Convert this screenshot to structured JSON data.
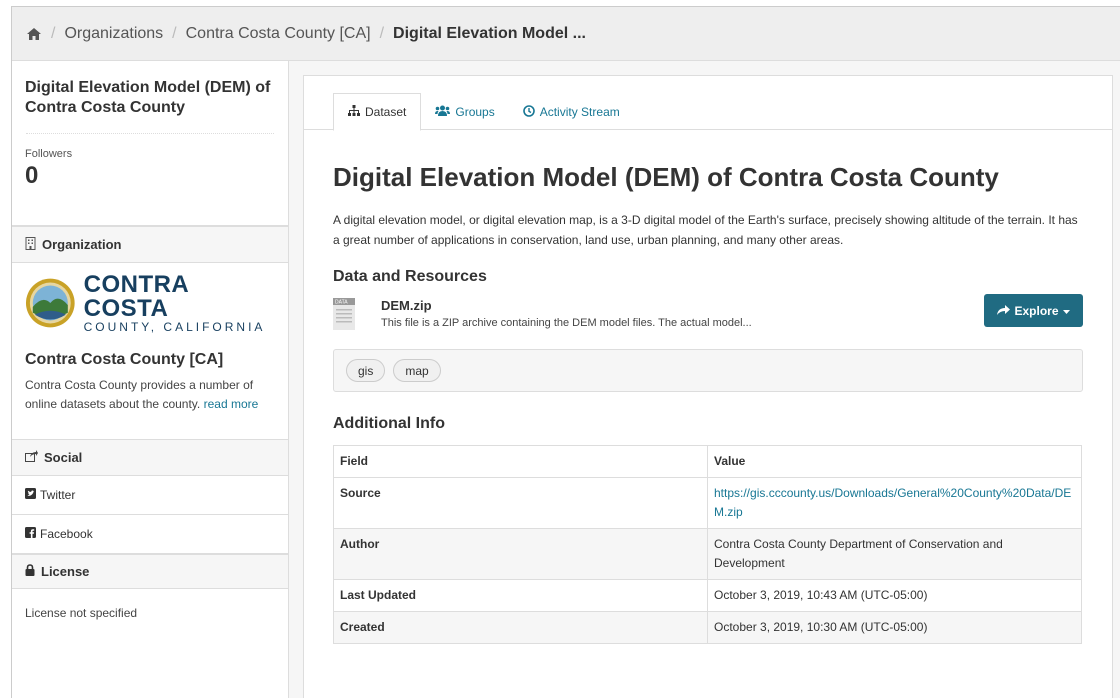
{
  "breadcrumb": {
    "home_icon": "home-icon",
    "items": [
      "Organizations",
      "Contra Costa County [CA]",
      "Digital Elevation Model ..."
    ]
  },
  "sidebar": {
    "title": "Digital Elevation Model (DEM) of Contra Costa County",
    "followers_label": "Followers",
    "followers_count": "0",
    "organization_heading": "Organization",
    "org_logo_big": "CONTRA COSTA",
    "org_logo_small": "COUNTY, CALIFORNIA",
    "org_name": "Contra Costa County [CA]",
    "org_description": "Contra Costa County provides a number of online datasets about the county.",
    "read_more": "read more",
    "social_heading": "Social",
    "twitter": "Twitter",
    "facebook": "Facebook",
    "license_heading": "License",
    "license_text": "License not specified"
  },
  "tabs": [
    {
      "label": "Dataset",
      "icon": "sitemap-icon",
      "active": true
    },
    {
      "label": "Groups",
      "icon": "users-icon",
      "active": false
    },
    {
      "label": "Activity Stream",
      "icon": "clock-icon",
      "active": false
    }
  ],
  "dataset": {
    "title": "Digital Elevation Model (DEM) of Contra Costa County",
    "description": "A digital elevation model, or digital elevation map, is a 3-D digital model of the Earth's surface, precisely showing altitude of the terrain. It has a great number of applications in conservation, land use, urban planning, and many other areas.",
    "resources_heading": "Data and Resources",
    "resource": {
      "format": "DATA",
      "name": "DEM.zip",
      "description": "This file is a ZIP archive containing the DEM model files. The actual model...",
      "explore_label": "Explore"
    },
    "tags": [
      "gis",
      "map"
    ],
    "additional_info_heading": "Additional Info",
    "table": {
      "headers": [
        "Field",
        "Value"
      ],
      "rows": [
        {
          "field": "Source",
          "value": "https://gis.cccounty.us/Downloads/General%20County%20Data/DEM.zip"
        },
        {
          "field": "Author",
          "value": "Contra Costa County Department of Conservation and Development"
        },
        {
          "field": "Last Updated",
          "value": "October 3, 2019, 10:43 AM (UTC-05:00)"
        },
        {
          "field": "Created",
          "value": "October 3, 2019, 10:30 AM (UTC-05:00)"
        }
      ]
    }
  },
  "colors": {
    "link": "#187794",
    "button": "#206b82",
    "logo": "#173f5f"
  }
}
